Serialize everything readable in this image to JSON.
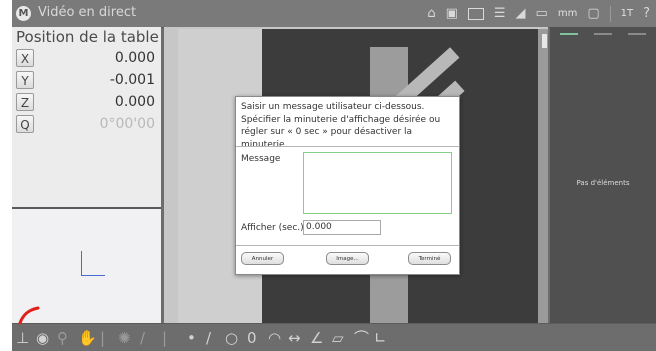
{
  "window": {
    "logo": "M",
    "title": "Vidéo en direct",
    "units": "mm",
    "counter": "1T",
    "help": "?"
  },
  "left_panel": {
    "title": "Position de la table",
    "axes": [
      {
        "label": "X",
        "value": "0.000"
      },
      {
        "label": "Y",
        "value": "-0.001"
      },
      {
        "label": "Z",
        "value": "0.000"
      },
      {
        "label": "Q",
        "value": "0°00'00"
      }
    ]
  },
  "right_panel": {
    "empty_text": "Pas d'éléments"
  },
  "dialog": {
    "instructions": "Saisir un message utilisateur ci-dessous. Spécifier la minuterie d'affichage désirée ou régler sur « 0 sec » pour désactiver la minuterie.",
    "message_label": "Message",
    "message_value": "",
    "display_label": "Afficher (sec.)",
    "display_value": "0.000",
    "cancel_label": "Annuler",
    "image_label": "Image...",
    "done_label": "Terminé"
  },
  "colors": {
    "accent_green": "#86cf88",
    "annotation_red": "#e0201b"
  }
}
